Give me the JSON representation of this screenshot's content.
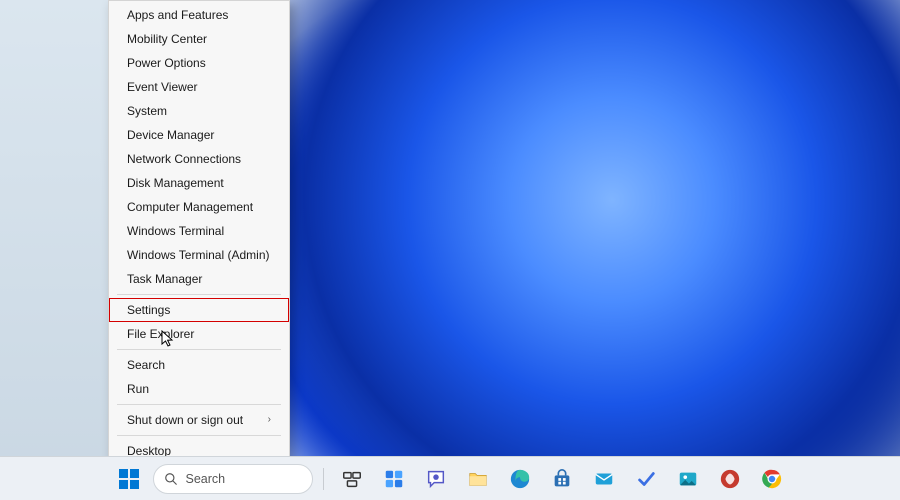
{
  "menu": {
    "items": [
      {
        "label": "Apps and Features",
        "name": "menu-item-apps-and-features"
      },
      {
        "label": "Mobility Center",
        "name": "menu-item-mobility-center"
      },
      {
        "label": "Power Options",
        "name": "menu-item-power-options"
      },
      {
        "label": "Event Viewer",
        "name": "menu-item-event-viewer"
      },
      {
        "label": "System",
        "name": "menu-item-system"
      },
      {
        "label": "Device Manager",
        "name": "menu-item-device-manager"
      },
      {
        "label": "Network Connections",
        "name": "menu-item-network-connections"
      },
      {
        "label": "Disk Management",
        "name": "menu-item-disk-management"
      },
      {
        "label": "Computer Management",
        "name": "menu-item-computer-management"
      },
      {
        "label": "Windows Terminal",
        "name": "menu-item-windows-terminal"
      },
      {
        "label": "Windows Terminal (Admin)",
        "name": "menu-item-windows-terminal-admin"
      },
      {
        "label": "Task Manager",
        "name": "menu-item-task-manager"
      },
      {
        "label": "Settings",
        "name": "menu-item-settings",
        "highlight": true
      },
      {
        "label": "File Explorer",
        "name": "menu-item-file-explorer"
      },
      {
        "label": "Search",
        "name": "menu-item-search"
      },
      {
        "label": "Run",
        "name": "menu-item-run"
      },
      {
        "label": "Shut down or sign out",
        "name": "menu-item-shutdown-signout",
        "submenu": true
      },
      {
        "label": "Desktop",
        "name": "menu-item-desktop"
      }
    ],
    "separators_after": [
      11,
      13,
      15,
      16
    ]
  },
  "taskbar": {
    "search_placeholder": "Search",
    "icons": [
      {
        "name": "start-button",
        "semantic": "windows-logo-icon"
      },
      {
        "name": "search",
        "semantic": "search-icon"
      },
      {
        "name": "task-view-button",
        "semantic": "task-view-icon"
      },
      {
        "name": "widgets-button",
        "semantic": "widgets-icon"
      },
      {
        "name": "chat-button",
        "semantic": "chat-icon"
      },
      {
        "name": "file-explorer-button",
        "semantic": "folder-icon"
      },
      {
        "name": "edge-button",
        "semantic": "edge-icon"
      },
      {
        "name": "store-button",
        "semantic": "store-icon"
      },
      {
        "name": "mail-button",
        "semantic": "mail-icon"
      },
      {
        "name": "todo-button",
        "semantic": "todo-icon"
      },
      {
        "name": "photos-button",
        "semantic": "photos-icon"
      },
      {
        "name": "app-button",
        "semantic": "app-red-icon"
      },
      {
        "name": "chrome-button",
        "semantic": "chrome-icon"
      }
    ]
  }
}
